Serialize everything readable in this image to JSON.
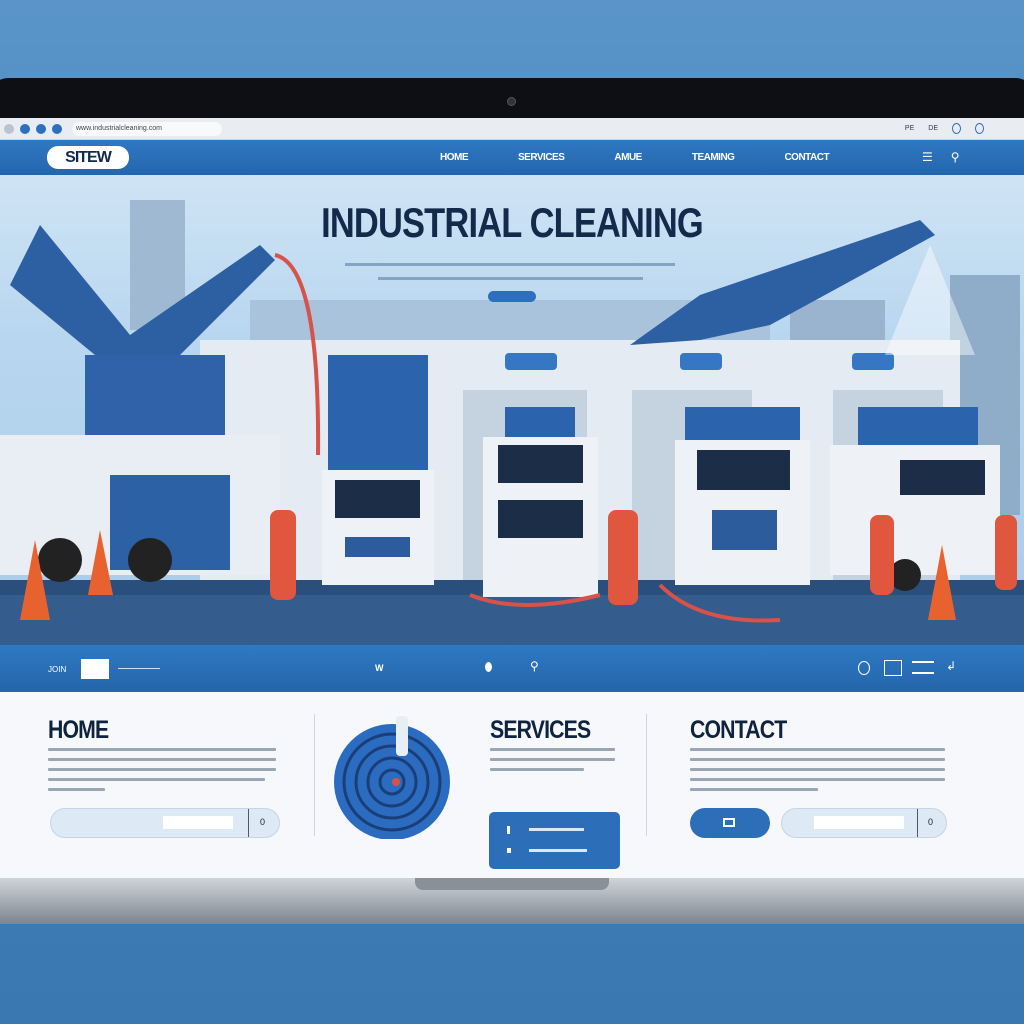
{
  "browser": {
    "url": "www.industrialcleaning.com",
    "right_items": [
      "PE",
      "DE"
    ]
  },
  "site": {
    "logo": "SITEW",
    "nav": [
      "HOME",
      "SERVICES",
      "AMUE",
      "TEAMING",
      "CONTACT"
    ],
    "nav_icons": [
      "menu-icon",
      "search-icon"
    ]
  },
  "hero": {
    "title": "INDUSTRIAL CLEANING",
    "button_label": "",
    "door_signs": [
      "",
      ""
    ]
  },
  "bluebar": {
    "left_label": "JOIN",
    "center_label": "W"
  },
  "columns": {
    "home": {
      "title": "HOME",
      "input_button": "0"
    },
    "services": {
      "title": "SERVICES",
      "items": [
        "",
        ""
      ]
    },
    "contact": {
      "title": "CONTACT",
      "input_button": "0"
    }
  },
  "colors": {
    "primary": "#2a6fb8",
    "dark": "#10233e",
    "accent": "#e05a3a",
    "background": "#4a88c0"
  }
}
